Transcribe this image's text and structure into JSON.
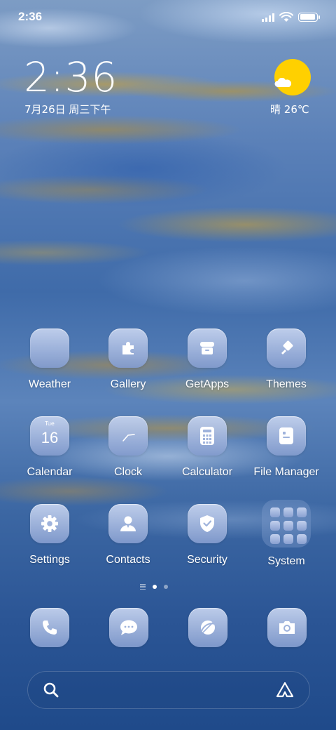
{
  "status_bar": {
    "time": "2:36",
    "icons": [
      "signal-icon",
      "wifi-icon",
      "battery-icon"
    ]
  },
  "clock_widget": {
    "time": "2:36",
    "date": "7月26日 周三下午"
  },
  "weather_widget": {
    "condition": "晴",
    "temperature": "26℃",
    "icon": "sunny-cloud-icon",
    "sun_color": "#ffd000"
  },
  "apps": [
    {
      "label": "Weather",
      "icon": "weather-icon"
    },
    {
      "label": "Gallery",
      "icon": "gallery-puzzle-icon"
    },
    {
      "label": "GetApps",
      "icon": "store-icon"
    },
    {
      "label": "Themes",
      "icon": "brush-icon"
    },
    {
      "label": "Calendar",
      "icon": "calendar-icon",
      "day": "Tue",
      "date": "16"
    },
    {
      "label": "Clock",
      "icon": "clock-icon"
    },
    {
      "label": "Calculator",
      "icon": "calculator-icon"
    },
    {
      "label": "File Manager",
      "icon": "file-manager-icon"
    },
    {
      "label": "Settings",
      "icon": "gear-icon"
    },
    {
      "label": "Contacts",
      "icon": "contact-icon"
    },
    {
      "label": "Security",
      "icon": "shield-check-icon"
    },
    {
      "label": "System",
      "icon": "folder-icon"
    }
  ],
  "page_indicator": {
    "pages": 2,
    "active": 1
  },
  "dock": [
    {
      "icon": "phone-icon"
    },
    {
      "icon": "messages-icon"
    },
    {
      "icon": "browser-icon"
    },
    {
      "icon": "camera-icon"
    }
  ],
  "search_bar": {
    "icons": [
      "search-icon",
      "assistant-icon"
    ]
  }
}
